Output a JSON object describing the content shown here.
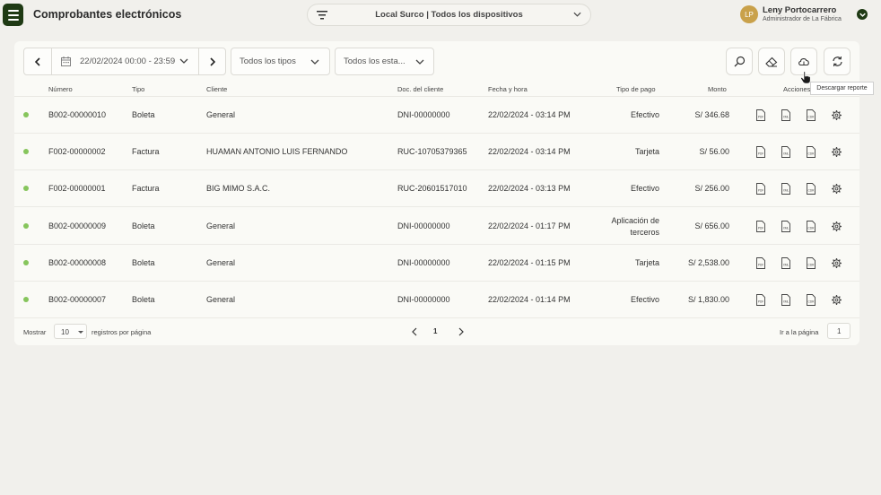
{
  "header": {
    "title": "Comprobantes electrónicos",
    "location": "Local Surco | Todos los dispositivos",
    "user": {
      "initials": "LP",
      "name": "Leny Portocarrero",
      "role": "Administrador de La Fábrica"
    }
  },
  "toolbar": {
    "date_range": "22/02/2024 00:00 - 23:59",
    "type_filter": "Todos los tipos",
    "state_filter": "Todos los esta...",
    "tooltip": "Descargar reporte"
  },
  "table": {
    "columns": {
      "numero": "Número",
      "tipo": "Tipo",
      "cliente": "Cliente",
      "doc": "Doc. del cliente",
      "fecha": "Fecha y hora",
      "pago": "Tipo de pago",
      "monto": "Monto",
      "acciones": "Acciones"
    },
    "rows": [
      {
        "numero": "B002-00000010",
        "tipo": "Boleta",
        "cliente": "General",
        "doc": "DNI-00000000",
        "fecha": "22/02/2024 - 03:14 PM",
        "pago": "Efectivo",
        "pago2": "",
        "monto": "S/ 346.68"
      },
      {
        "numero": "F002-00000002",
        "tipo": "Factura",
        "cliente": "HUAMAN ANTONIO LUIS FERNANDO",
        "doc": "RUC-10705379365",
        "fecha": "22/02/2024 - 03:14 PM",
        "pago": "Tarjeta",
        "pago2": "",
        "monto": "S/ 56.00"
      },
      {
        "numero": "F002-00000001",
        "tipo": "Factura",
        "cliente": "BIG MIMO S.A.C.",
        "doc": "RUC-20601517010",
        "fecha": "22/02/2024 - 03:13 PM",
        "pago": "Efectivo",
        "pago2": "",
        "monto": "S/ 256.00"
      },
      {
        "numero": "B002-00000009",
        "tipo": "Boleta",
        "cliente": "General",
        "doc": "DNI-00000000",
        "fecha": "22/02/2024 - 01:17 PM",
        "pago": "Aplicación de",
        "pago2": "terceros",
        "monto": "S/ 656.00"
      },
      {
        "numero": "B002-00000008",
        "tipo": "Boleta",
        "cliente": "General",
        "doc": "DNI-00000000",
        "fecha": "22/02/2024 - 01:15 PM",
        "pago": "Tarjeta",
        "pago2": "",
        "monto": "S/ 2,538.00"
      },
      {
        "numero": "B002-00000007",
        "tipo": "Boleta",
        "cliente": "General",
        "doc": "DNI-00000000",
        "fecha": "22/02/2024 - 01:14 PM",
        "pago": "Efectivo",
        "pago2": "",
        "monto": "S/ 1,830.00"
      }
    ],
    "action_labels": {
      "pdf": "PDF",
      "xml": "XML",
      "cdr": "CDR"
    }
  },
  "footer": {
    "show_label": "Mostrar",
    "page_size": "10",
    "per_page_label": "registros por página",
    "current_page": "1",
    "goto_label": "Ir a la página",
    "goto_value": "1"
  },
  "colors": {
    "brand": "#1f3a14",
    "avatar": "#c9a14a",
    "status_ok": "#86c55c"
  }
}
